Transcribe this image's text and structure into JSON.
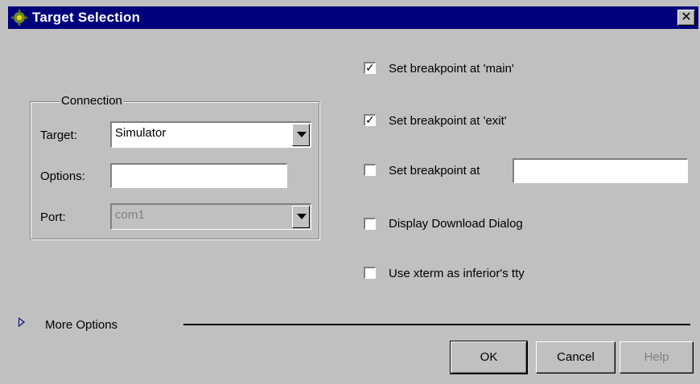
{
  "window": {
    "title": "Target Selection",
    "icon": "gear-app-icon",
    "close_label": "✕"
  },
  "connection": {
    "group_title": "Connection",
    "target_label": "Target:",
    "target_value": "Simulator",
    "options_label": "Options:",
    "options_value": "",
    "port_label": "Port:",
    "port_value": "com1"
  },
  "options": [
    {
      "label": "Set breakpoint at 'main'",
      "checked": true
    },
    {
      "label": "Set breakpoint at 'exit'",
      "checked": true
    },
    {
      "label": "Set breakpoint at",
      "checked": false,
      "value": ""
    },
    {
      "label": "Display Download Dialog",
      "checked": false
    },
    {
      "label": "Use xterm as inferior's tty",
      "checked": false
    }
  ],
  "more_options_label": "More Options",
  "buttons": {
    "ok": "OK",
    "cancel": "Cancel",
    "help": "Help"
  },
  "colors": {
    "titlebar": "#00007c",
    "face": "#c0c0c0"
  }
}
